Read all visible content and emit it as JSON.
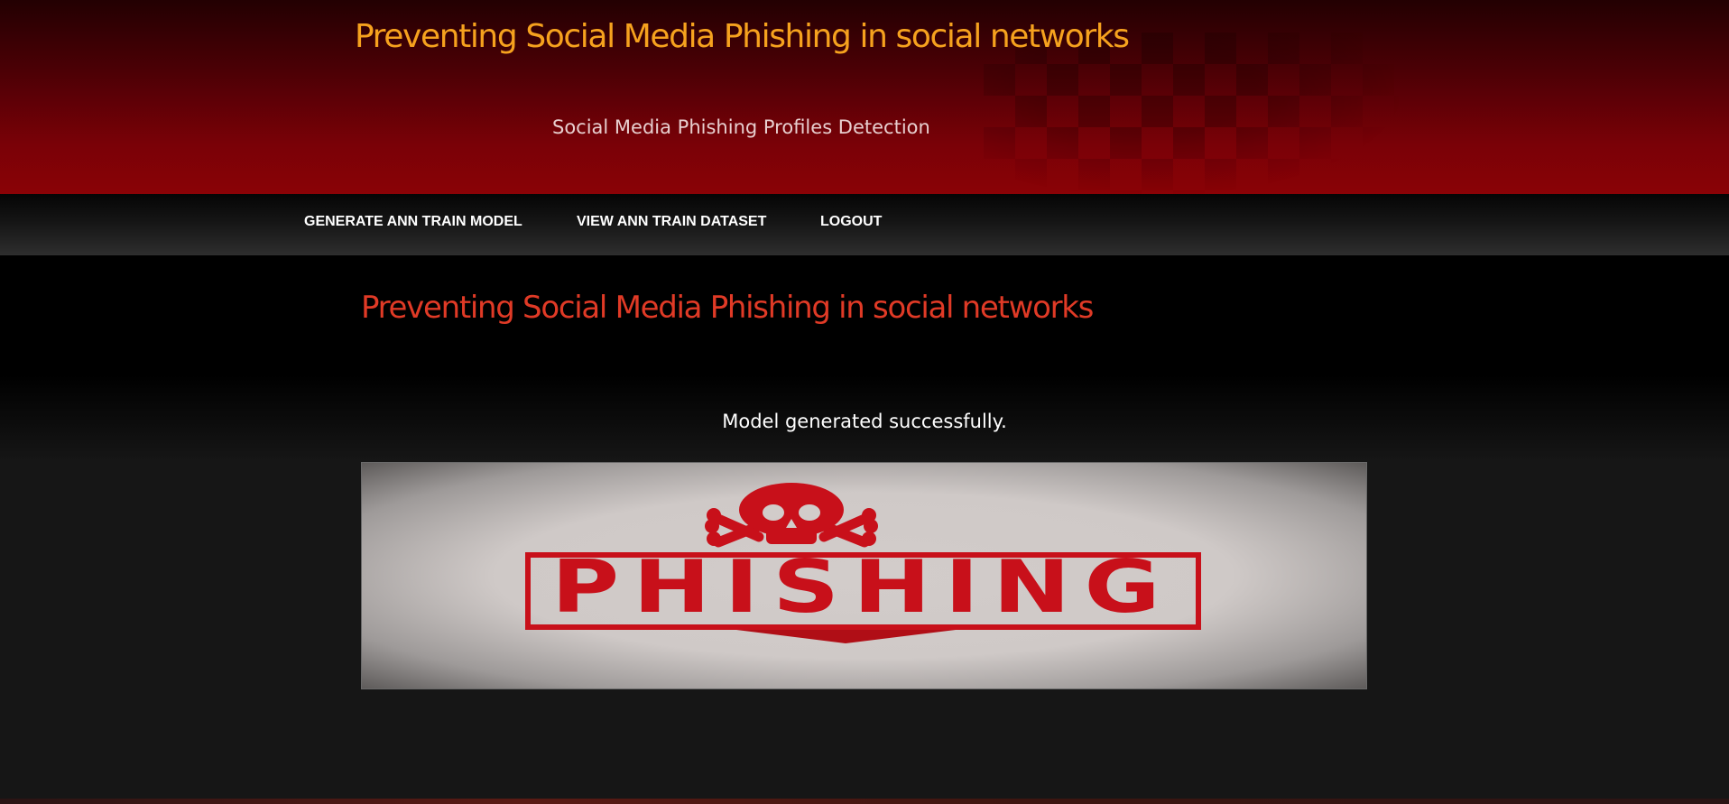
{
  "header": {
    "title": "Preventing Social Media Phishing in social networks",
    "subtitle": "Social Media Phishing Profiles Detection"
  },
  "nav": {
    "items": [
      {
        "label": "GENERATE ANN TRAIN MODEL"
      },
      {
        "label": "VIEW ANN TRAIN DATASET"
      },
      {
        "label": "LOGOUT"
      }
    ]
  },
  "main": {
    "title": "Preventing Social Media Phishing in social networks",
    "status_message": "Model generated successfully."
  },
  "banner": {
    "text": "PHISHING",
    "icon": "skull-crossbones-icon",
    "accent_color": "#c8101a"
  },
  "colors": {
    "site_title": "#f6a21e",
    "content_title": "#e03a26",
    "header_red": "#8a0206"
  }
}
